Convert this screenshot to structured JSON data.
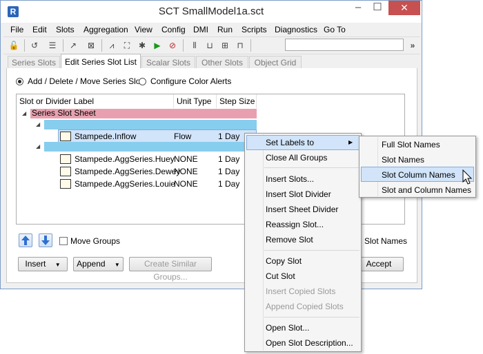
{
  "window": {
    "title": "SCT SmallModel1a.sct",
    "app_icon_glyph": "R"
  },
  "titlebar_buttons": {
    "minimize": "–",
    "maximize": "☐",
    "close": "✕"
  },
  "menubar": [
    "File",
    "Edit",
    "Slots",
    "Aggregation",
    "View",
    "Config",
    "DMI",
    "Run",
    "Scripts",
    "Diagnostics",
    "Go To"
  ],
  "toolbar": {
    "overflow": "»"
  },
  "tabs": [
    {
      "label": "Series Slots",
      "active": false
    },
    {
      "label": "Edit Series Slot List",
      "active": true
    },
    {
      "label": "Scalar Slots",
      "active": false
    },
    {
      "label": "Other Slots",
      "active": false
    },
    {
      "label": "Object Grid",
      "active": false
    }
  ],
  "mode": {
    "option1": "Add / Delete / Move Series Slot",
    "option2": "Configure Color Alerts",
    "selected": "option1"
  },
  "tree": {
    "columns": [
      "Slot or Divider Label",
      "Unit Type",
      "Step Size"
    ],
    "sheet_label": "Series Slot Sheet",
    "rows": [
      {
        "label": "Stampede.Inflow",
        "unit": "Flow",
        "step": "1 Day"
      },
      {
        "label": "Stampede.AggSeries.Huey",
        "unit": "NONE",
        "step": "1 Day"
      },
      {
        "label": "Stampede.AggSeries.Dewey",
        "unit": "NONE",
        "step": "1 Day"
      },
      {
        "label": "Stampede.AggSeries.Louie",
        "unit": "NONE",
        "step": "1 Day"
      }
    ]
  },
  "bottom": {
    "move_groups": "Move Groups",
    "slot_names_partial": "Slot Names",
    "insert": "Insert",
    "append": "Append",
    "create_similar": "Create Similar Groups...",
    "accept": "Accept"
  },
  "context_menu": {
    "items": [
      {
        "label": "Set Labels to",
        "submenu": true,
        "highlighted": true
      },
      {
        "label": "Close All Groups"
      },
      {
        "sep": true
      },
      {
        "label": "Insert Slots..."
      },
      {
        "label": "Insert Slot Divider"
      },
      {
        "label": "Insert Sheet Divider"
      },
      {
        "label": "Reassign Slot..."
      },
      {
        "label": "Remove Slot"
      },
      {
        "sep": true
      },
      {
        "label": "Copy Slot"
      },
      {
        "label": "Cut Slot"
      },
      {
        "label": "Insert Copied Slots",
        "disabled": true
      },
      {
        "label": "Append Copied Slots",
        "disabled": true
      },
      {
        "sep": true
      },
      {
        "label": "Open Slot..."
      },
      {
        "label": "Open Slot Description..."
      }
    ],
    "submenu_arrow": "▶"
  },
  "submenu": {
    "items": [
      "Full Slot Names",
      "Slot Names",
      "Slot Column Names",
      "Slot and Column Names"
    ],
    "highlighted": 2
  },
  "colors": {
    "sheet_row": "#e8a0b0",
    "divider_row": "#87cdee",
    "selection": "#d1e4f9",
    "close_button": "#c75050"
  }
}
